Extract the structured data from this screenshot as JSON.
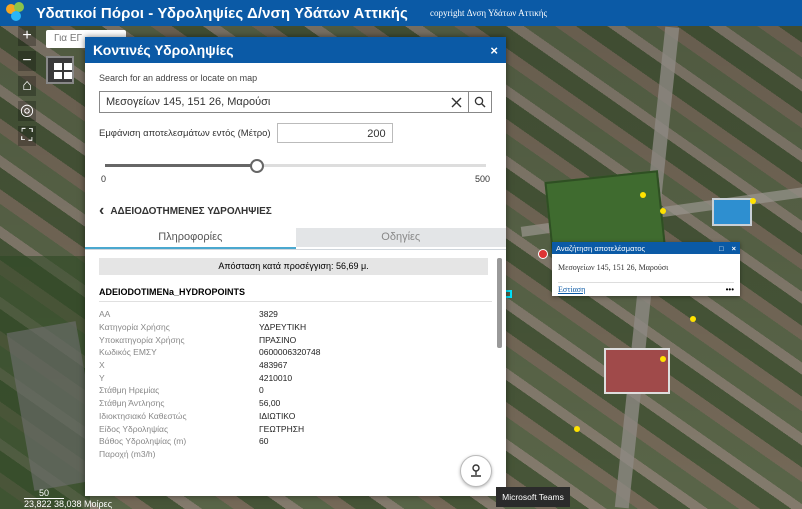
{
  "header": {
    "title": "Υδατικοί Πόροι - Υδροληψίες Δ/νση Υδάτων Αττικής",
    "copyright": "copyright Δνση Υδάτων Αττικής"
  },
  "map": {
    "search_placeholder": "Για ΕΓ",
    "tools": [
      "+",
      "−",
      "⌂",
      "◎",
      "⛶"
    ],
    "scale_label": "50",
    "coordinates": "23,822 38,038 Μοίρες"
  },
  "panel": {
    "title": "Κοντινές Υδροληψίες",
    "close_label": "×",
    "search_label": "Search for an address or locate on map",
    "search_value": "Μεσογείων 145, 151 26, Μαρούσι",
    "distance_label": "Εμφάνιση αποτελεσμάτων εντός (Μέτρο)",
    "distance_value": "200",
    "slider": {
      "min": "0",
      "max": "500",
      "value": 200
    },
    "back_label": "ΑΔΕΙΟΔΟΤΗΜΕΝΕΣ ΥΔΡΟΛΗΨΙΕΣ",
    "tabs": [
      {
        "label": "Πληροφορίες",
        "active": true
      },
      {
        "label": "Οδηγίες",
        "active": false
      }
    ],
    "distance_text": "Απόσταση κατά προσέγγιση: 56,69 μ.",
    "layer_name": "ADEIODOTIMENa_HYDROPOINTS",
    "attributes": [
      {
        "key": "ΑΑ",
        "value": "3829"
      },
      {
        "key": "Κατηγορία Χρήσης",
        "value": "ΥΔΡΕΥΤΙΚΗ"
      },
      {
        "key": "Υποκατηγορία Χρήσης",
        "value": "ΠΡΑΣΙΝΟ"
      },
      {
        "key": "Κωδικός ΕΜΣΥ",
        "value": "0600006320748"
      },
      {
        "key": "X",
        "value": "483967"
      },
      {
        "key": "Y",
        "value": "4210010"
      },
      {
        "key": "Στάθμη Ηρεμίας",
        "value": "0"
      },
      {
        "key": "Στάθμη Άντλησης",
        "value": "56,00"
      },
      {
        "key": "Ιδιοκτησιακό Καθεστώς",
        "value": "ΙΔΙΩΤΙΚΟ"
      },
      {
        "key": "Είδος Υδροληψίας",
        "value": "ΓΕΩΤΡΗΣΗ"
      },
      {
        "key": "Βάθος Υδροληψίας (m)",
        "value": "60"
      },
      {
        "key": "Παροχή (m3/h)",
        "value": ""
      }
    ]
  },
  "popup": {
    "title": "Αναζήτηση αποτελέσματος",
    "address": "Μεσογείων 145, 151 26, Μαρούσι",
    "zoom_link": "Εστίαση",
    "more": "•••"
  },
  "taskbar": {
    "teams_tooltip": "Microsoft Teams"
  },
  "colors": {
    "brand": "#0b5aa6",
    "accent_tab": "#4aa8cf"
  }
}
